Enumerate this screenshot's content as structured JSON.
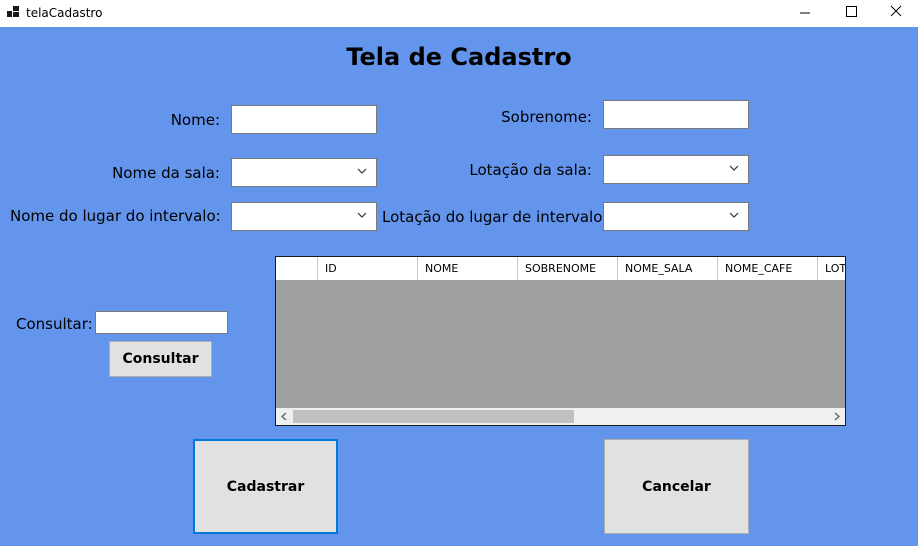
{
  "window": {
    "title": "telaCadastro"
  },
  "form": {
    "title": "Tela de Cadastro",
    "nome_label": "Nome:",
    "sobrenome_label": "Sobrenome:",
    "nome_sala_label": "Nome da sala:",
    "lotacao_sala_label": "Lotação da sala:",
    "nome_lugar_intervalo_label": "Nome do lugar do intervalo:",
    "lotacao_lugar_intervalo_label": "Lotação do lugar de intervalo:",
    "consultar_label": "Consultar:",
    "consultar_button": "Consultar",
    "cadastrar_button": "Cadastrar",
    "cancelar_button": "Cancelar"
  },
  "grid": {
    "columns": [
      "ID",
      "NOME",
      "SOBRENOME",
      "NOME_SALA",
      "NOME_CAFE",
      "LOT"
    ]
  }
}
